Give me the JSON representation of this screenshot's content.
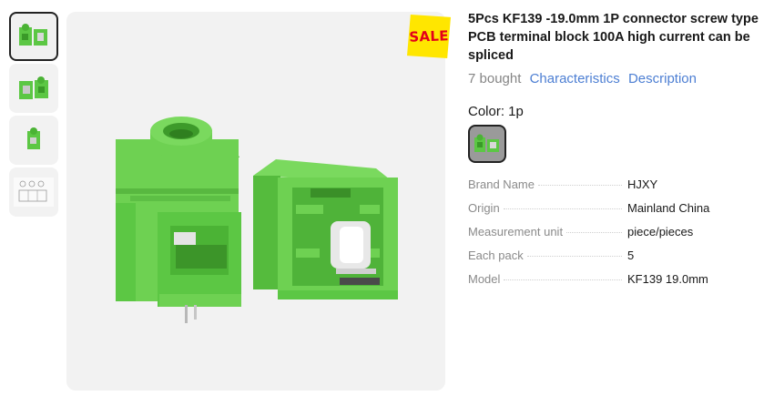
{
  "product": {
    "title": "5Pcs KF139 -19.0mm 1P connector screw type PCB terminal block 100A high current can be spliced",
    "bought": "7 bought",
    "links": {
      "characteristics": "Characteristics",
      "description": "Description"
    },
    "sale_badge": "SALE"
  },
  "gallery": {
    "thumbnails": [
      {
        "icon": "two-green-blocks-thumb",
        "selected": true
      },
      {
        "icon": "two-green-blocks-thumb-alt",
        "selected": false
      },
      {
        "icon": "single-green-block-thumb",
        "selected": false
      },
      {
        "icon": "technical-drawing-thumb",
        "selected": false
      }
    ],
    "main_image": "green-terminal-blocks-image"
  },
  "variant": {
    "color_label": "Color: 1p",
    "swatch_icon": "two-green-blocks-swatch"
  },
  "specs": [
    {
      "key": "Brand Name",
      "value": "HJXY"
    },
    {
      "key": "Origin",
      "value": "Mainland China"
    },
    {
      "key": "Measurement unit",
      "value": "piece/pieces"
    },
    {
      "key": "Each pack",
      "value": "5"
    },
    {
      "key": "Model",
      "value": "KF139 19.0mm"
    }
  ],
  "colors": {
    "link": "#4d7fd3",
    "product_green": "#6ed152",
    "sale_yellow": "#ffe600",
    "sale_red": "#e3001b"
  }
}
